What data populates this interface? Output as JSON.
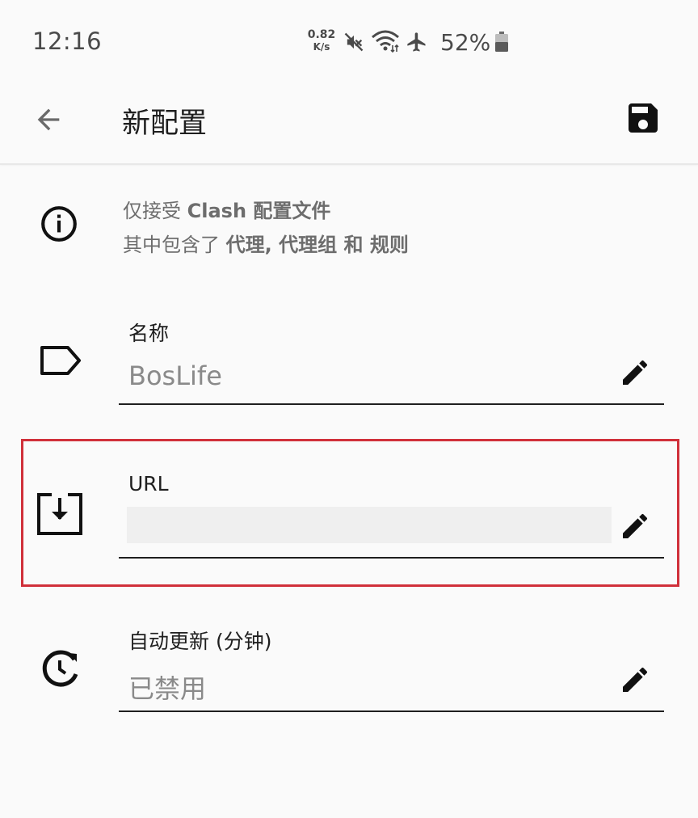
{
  "status_bar": {
    "time": "12:16",
    "net_speed_value": "0.82",
    "net_speed_unit": "K/s",
    "battery_percent": "52%",
    "icons": [
      "mute-icon",
      "wifi-icon",
      "airplane-icon",
      "battery-icon"
    ]
  },
  "app_bar": {
    "title": "新配置",
    "back_icon": "arrow-back-icon",
    "save_icon": "save-icon"
  },
  "info": {
    "line1_prefix": "仅接受 ",
    "line1_bold": "Clash 配置文件",
    "line2_prefix": "其中包含了 ",
    "line2_bold": "代理, 代理组 和 规则"
  },
  "fields": {
    "name": {
      "label": "名称",
      "value": "BosLife",
      "icon": "label-tag-icon"
    },
    "url": {
      "label": "URL",
      "value": "",
      "icon": "download-icon"
    },
    "auto_update": {
      "label": "自动更新 (分钟)",
      "value": "已禁用",
      "icon": "clock-update-icon"
    }
  },
  "colors": {
    "background": "#fafafa",
    "text_primary": "#1f1f1f",
    "text_secondary": "#6d6d6d",
    "value_text": "#8a8a8a",
    "highlight": "#d0303a"
  }
}
